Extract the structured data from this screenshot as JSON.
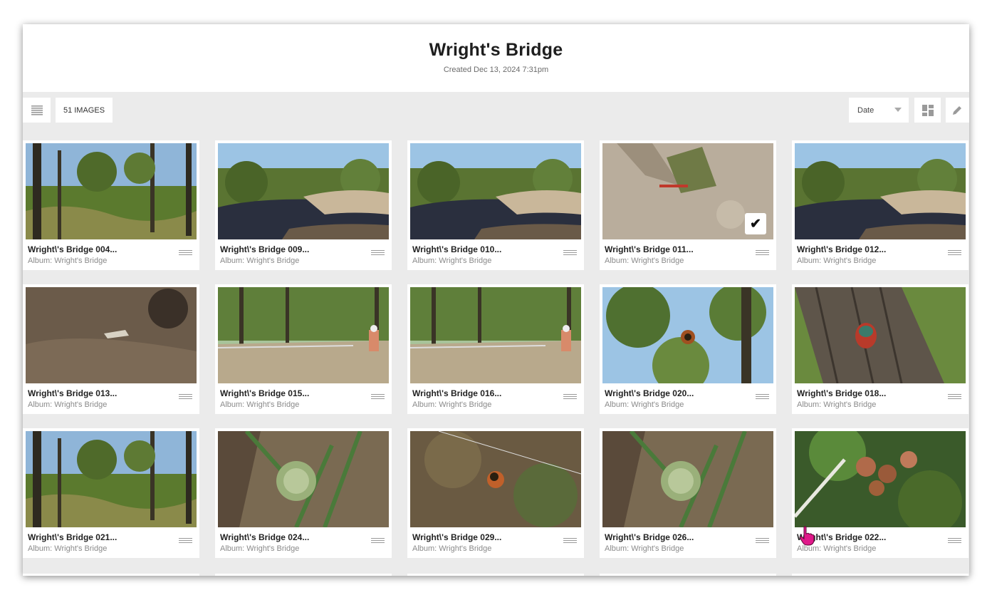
{
  "album": {
    "title": "Wright's Bridge",
    "created": "Created Dec 13, 2024 7:31pm"
  },
  "toolbar": {
    "menu_icon": "list-icon",
    "image_count": "51 IMAGES",
    "sort_label": "Date",
    "layout_icon": "grid-layout-icon",
    "edit_icon": "pencil-icon"
  },
  "images": [
    {
      "title": "Wright\\'s Bridge 004...",
      "album": "Album: Wright's Bridge",
      "scene": "forest"
    },
    {
      "title": "Wright\\'s Bridge 009...",
      "album": "Album: Wright's Bridge",
      "scene": "river"
    },
    {
      "title": "Wright\\'s Bridge 010...",
      "album": "Album: Wright's Bridge",
      "scene": "river"
    },
    {
      "title": "Wright\\'s Bridge 011...",
      "album": "Album: Wright's Bridge",
      "scene": "ground",
      "selected": true
    },
    {
      "title": "Wright\\'s Bridge 012...",
      "album": "Album: Wright's Bridge",
      "scene": "river"
    },
    {
      "title": "Wright\\'s Bridge 013...",
      "album": "Album: Wright's Bridge",
      "scene": "rock"
    },
    {
      "title": "Wright\\'s Bridge 015...",
      "album": "Album: Wright's Bridge",
      "scene": "path"
    },
    {
      "title": "Wright\\'s Bridge 016...",
      "album": "Album: Wright's Bridge",
      "scene": "path"
    },
    {
      "title": "Wright\\'s Bridge 020...",
      "album": "Album: Wright's Bridge",
      "scene": "spider"
    },
    {
      "title": "Wright\\'s Bridge 018...",
      "album": "Album: Wright's Bridge",
      "scene": "tree"
    },
    {
      "title": "Wright\\'s Bridge 021...",
      "album": "Album: Wright's Bridge",
      "scene": "forest"
    },
    {
      "title": "Wright\\'s Bridge 024...",
      "album": "Album: Wright's Bridge",
      "scene": "plant"
    },
    {
      "title": "Wright\\'s Bridge 029...",
      "album": "Album: Wright's Bridge",
      "scene": "web"
    },
    {
      "title": "Wright\\'s Bridge 026...",
      "album": "Album: Wright's Bridge",
      "scene": "plant"
    },
    {
      "title": "Wright\\'s Bridge 022...",
      "album": "Album: Wright's Bridge",
      "scene": "fruit"
    }
  ],
  "colors": {
    "background": "#ebebeb",
    "card": "#ffffff",
    "cursor": "#e0198a"
  }
}
